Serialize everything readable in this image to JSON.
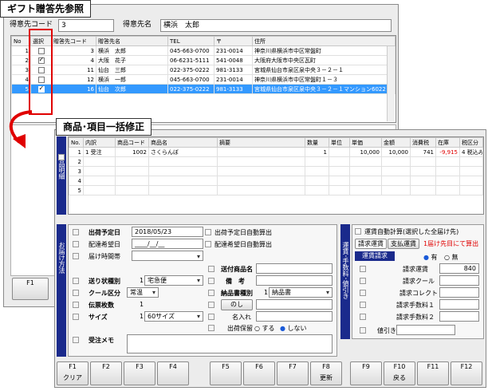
{
  "gift": {
    "title": "ギフト贈答先参照",
    "code_label": "得意先コード",
    "code_value": "3",
    "name_label": "得意先名",
    "name_value": "横浜　太郎",
    "columns": [
      "No",
      "選択",
      "贈答先コード",
      "贈答先名",
      "TEL",
      "〒",
      "住所"
    ],
    "rows": [
      {
        "no": "1",
        "checked": false,
        "code": "3",
        "name": "横浜　太郎",
        "tel": "045-663-0700",
        "zip": "231-0014",
        "addr": "神奈川県横浜市中区常盤町",
        "sel": false
      },
      {
        "no": "2",
        "checked": true,
        "code": "4",
        "name": "大阪　花子",
        "tel": "06-6231-5111",
        "zip": "541-0048",
        "addr": "大阪府大阪市中央区瓦町",
        "sel": false
      },
      {
        "no": "3",
        "checked": false,
        "code": "11",
        "name": "仙台　三郎",
        "tel": "022-375-0222",
        "zip": "981-3133",
        "addr": "宮城県仙台市泉区泉中央３－２－１",
        "sel": false
      },
      {
        "no": "4",
        "checked": false,
        "code": "12",
        "name": "横浜　一郎",
        "tel": "045-663-0700",
        "zip": "231-0014",
        "addr": "神奈川県横浜市中区常盤町１－３",
        "sel": false
      },
      {
        "no": "5",
        "checked": true,
        "code": "16",
        "name": "仙台　次郎",
        "tel": "022-375-0222",
        "zip": "981-3133",
        "addr": "宮城県仙台市泉区泉中央３－２－１マンション6022",
        "sel": true
      }
    ],
    "fkeys": [
      {
        "key": "F1",
        "label": ""
      }
    ]
  },
  "shohin": {
    "title": "商品･項目一括修正",
    "side_label": "商品明細",
    "columns": [
      "No.",
      "内訳",
      "商品コード",
      "商品名",
      "摘要",
      "数量",
      "単位",
      "単価",
      "金額",
      "消費税",
      "在庫",
      "税区分"
    ],
    "rows": [
      {
        "no": "1",
        "uchi": "1 受注",
        "code": "1002",
        "name": "さくらんぼ",
        "teki": "",
        "qty": "1",
        "unit": "",
        "price": "10,000",
        "amount": "10,000",
        "tax": "741",
        "stock": "-9,915",
        "taxkbn": "4 税込み"
      },
      {
        "no": "2",
        "uchi": "",
        "code": "",
        "name": "",
        "teki": "",
        "qty": "",
        "unit": "",
        "price": "",
        "amount": "",
        "tax": "",
        "stock": "",
        "taxkbn": ""
      },
      {
        "no": "3",
        "uchi": "",
        "code": "",
        "name": "",
        "teki": "",
        "qty": "",
        "unit": "",
        "price": "",
        "amount": "",
        "tax": "",
        "stock": "",
        "taxkbn": ""
      },
      {
        "no": "4",
        "uchi": "",
        "code": "",
        "name": "",
        "teki": "",
        "qty": "",
        "unit": "",
        "price": "",
        "amount": "",
        "tax": "",
        "stock": "",
        "taxkbn": ""
      },
      {
        "no": "5",
        "uchi": "",
        "code": "",
        "name": "",
        "teki": "",
        "qty": "",
        "unit": "",
        "price": "",
        "amount": "",
        "tax": "",
        "stock": "",
        "taxkbn": ""
      }
    ]
  },
  "otodoke": {
    "side_label": "お届け方法",
    "ship_date_label": "出荷予定日",
    "ship_date_value": "2018/05/23",
    "ship_auto_label": "出荷予定日自動算出",
    "deliv_date_label": "配達希望日",
    "deliv_date_value": "____/__/__",
    "deliv_auto_label": "配達希望日自動算出",
    "deliv_time_label": "届け時間帯",
    "slip_kind_label": "送り状種別",
    "slip_kind_num": "1",
    "slip_kind_value": "宅急便",
    "cool_label": "クール区分",
    "cool_value": "常温",
    "count_label": "伝票枚数",
    "count_value": "1",
    "size_label": "サイズ",
    "size_num": "1",
    "size_value": "60サイズ",
    "memo_label": "受注メモ",
    "goods_name_label": "送付商品名",
    "note_label": "備　考",
    "invoice_label": "納品書種別",
    "invoice_num": "1",
    "invoice_value": "納品書",
    "noshi_label": "のし",
    "nameplate_label": "名入れ",
    "shipstop_label": "出荷保留",
    "opt_yes": "する",
    "opt_no": "しない"
  },
  "unchin": {
    "side_label": "運賃･手数料･値引き",
    "auto_calc_label": "運賃自動計算(選択した全届け先)",
    "tab1": "請求運賃",
    "tab2": "支払運賃",
    "first_only_label": "1届け先目にて算出",
    "header_label": "運賃請求",
    "opt_yes": "有",
    "opt_no": "無",
    "fee_label": "請求運賃",
    "fee_value": "840",
    "cool_label": "請求クール",
    "collect_label": "請求コレクト",
    "fee1_label": "請求手数料１",
    "fee2_label": "請求手数料２",
    "discount_label": "値引き",
    "accent": "#1a2a8c",
    "warn": "#e00000"
  },
  "fkeys": [
    {
      "key": "F1",
      "label": "クリア"
    },
    {
      "key": "F2",
      "label": ""
    },
    {
      "key": "F3",
      "label": ""
    },
    {
      "key": "F4",
      "label": ""
    },
    {
      "key": "F5",
      "label": ""
    },
    {
      "key": "F6",
      "label": ""
    },
    {
      "key": "F7",
      "label": ""
    },
    {
      "key": "F8",
      "label": "更新"
    },
    {
      "key": "F9",
      "label": ""
    },
    {
      "key": "F10",
      "label": "戻る"
    },
    {
      "key": "F11",
      "label": ""
    },
    {
      "key": "F12",
      "label": ""
    }
  ]
}
